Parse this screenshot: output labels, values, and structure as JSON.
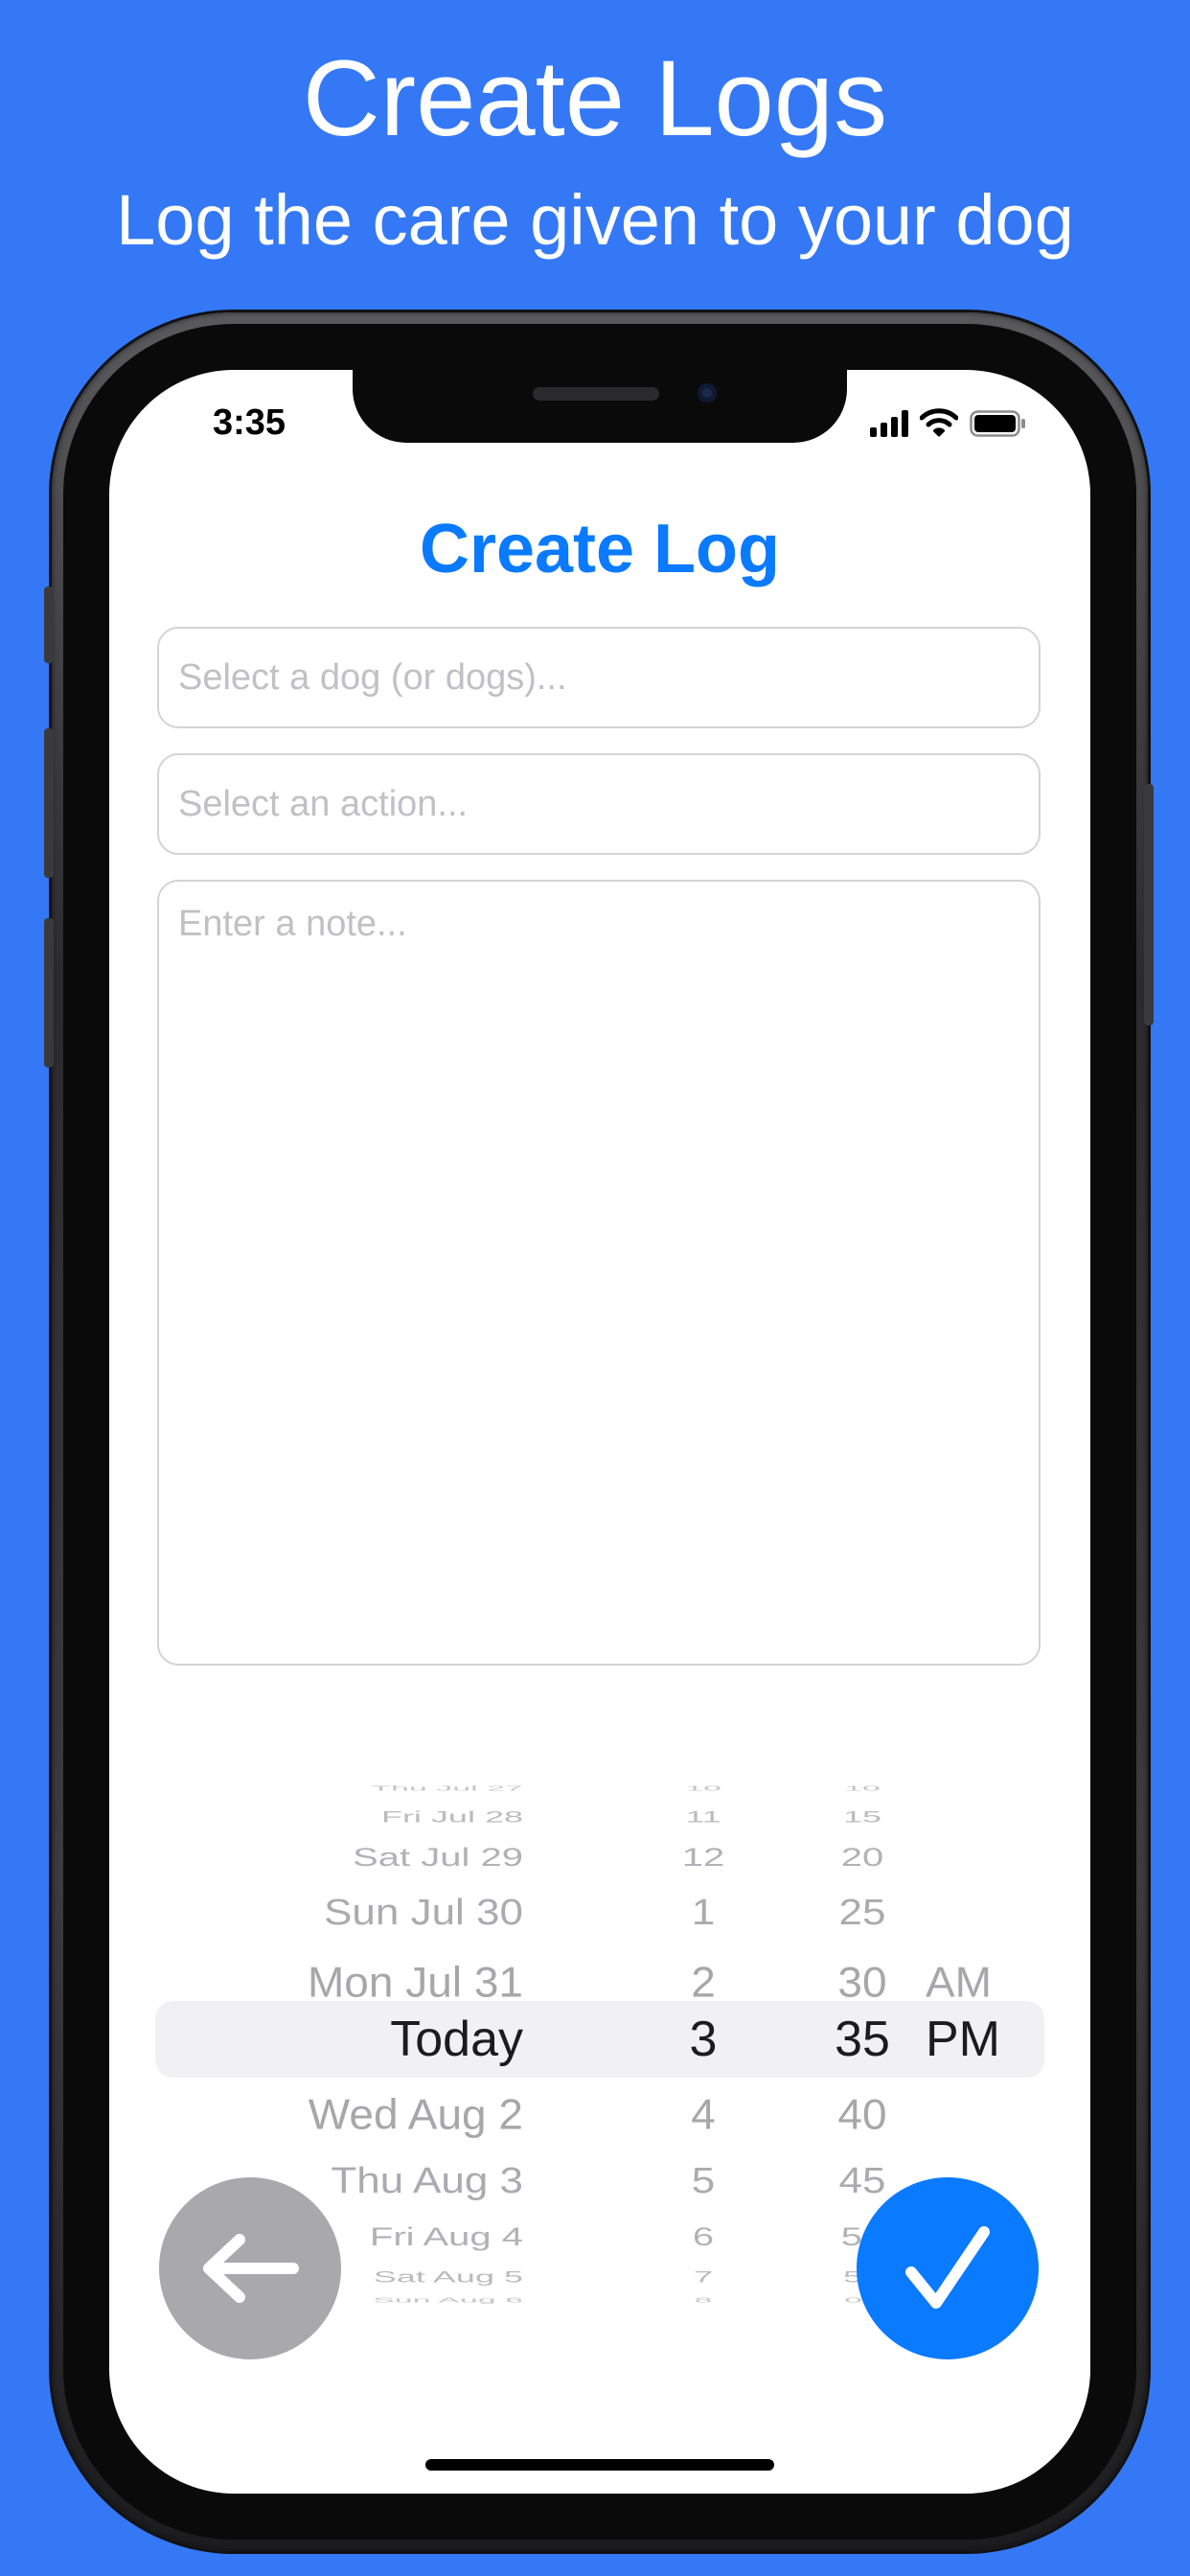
{
  "promo": {
    "title": "Create Logs",
    "subtitle": "Log the care given to your dog"
  },
  "status_bar": {
    "time": "3:35"
  },
  "screen": {
    "title": "Create Log",
    "dog_field": {
      "placeholder": "Select a dog (or dogs)..."
    },
    "action_field": {
      "placeholder": "Select an action..."
    },
    "note_field": {
      "placeholder": "Enter a note..."
    }
  },
  "date_picker": {
    "dates": [
      "Thu Jul 27",
      "Fri Jul 28",
      "Sat Jul 29",
      "Sun Jul 30",
      "Mon Jul 31",
      "Today",
      "Wed Aug 2",
      "Thu Aug 3",
      "Fri Aug 4",
      "Sat Aug 5",
      "Sun Aug 6"
    ],
    "hours": [
      "10",
      "11",
      "12",
      "1",
      "2",
      "3",
      "4",
      "5",
      "6",
      "7",
      "8"
    ],
    "minutes": [
      "10",
      "15",
      "20",
      "25",
      "30",
      "35",
      "40",
      "45",
      "50",
      "55",
      "00"
    ],
    "meridiem": [
      "AM",
      "PM"
    ],
    "selected": {
      "date": "Today",
      "hour": "3",
      "minute": "35",
      "meridiem": "PM"
    }
  },
  "buttons": {
    "back_icon": "arrow-left-icon",
    "confirm_icon": "checkmark-icon"
  },
  "colors": {
    "background": "#3478f6",
    "accent": "#0a7aff",
    "back_button": "#a9a9ac",
    "placeholder": "#c1c1c5"
  }
}
